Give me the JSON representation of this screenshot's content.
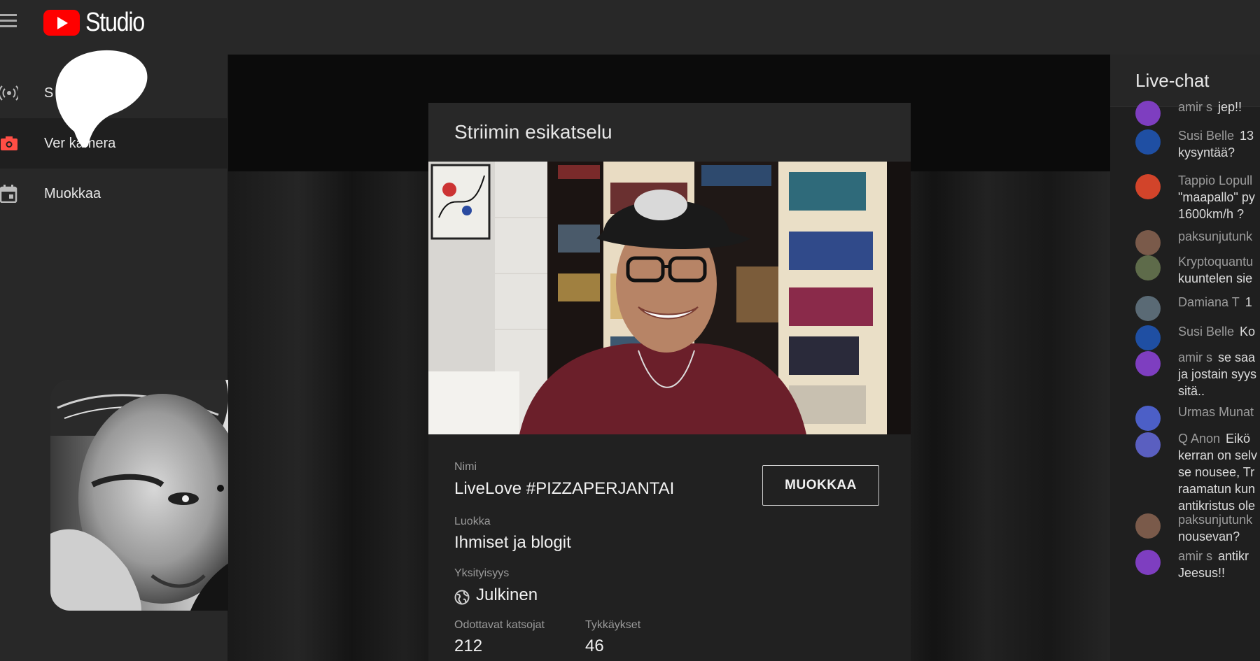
{
  "app": {
    "brand": "Studio"
  },
  "sidebar": {
    "items": [
      {
        "label": "S",
        "icon": "broadcast-icon"
      },
      {
        "label": "Ver kamera",
        "icon": "camera-icon"
      },
      {
        "label": "Muokkaa",
        "icon": "calendar-icon"
      }
    ]
  },
  "preview": {
    "title": "Striimin esikatselu",
    "name_label": "Nimi",
    "name_value": "LiveLove #PIZZAPERJANTAI",
    "edit_button": "MUOKKAA",
    "category_label": "Luokka",
    "category_value": "Ihmiset ja blogit",
    "privacy_label": "Yksityisyys",
    "privacy_value": "Julkinen",
    "viewers_label": "Odottavat katsojat",
    "viewers_value": "212",
    "likes_label": "Tykkäykset",
    "likes_value": "46"
  },
  "chat": {
    "title": "Live-chat",
    "messages": [
      {
        "author": "amir s",
        "text": "jep!!",
        "avatar_color": "#7e3ec0"
      },
      {
        "author": "Susi Belle",
        "text": "13\nkysyntää?",
        "avatar_color": "#1f4fa3"
      },
      {
        "author": "Tappio Lopull",
        "text": "\n\"maapallo\" py\n1600km/h ?",
        "avatar_color": "#d2442a"
      },
      {
        "author": "paksunjutunk",
        "text": "",
        "avatar_color": "#7a5a4a"
      },
      {
        "author": "Kryptoquantu",
        "text": "\nkuuntelen sie",
        "avatar_color": "#5e6b4a"
      },
      {
        "author": "Damiana T",
        "text": "1",
        "avatar_color": "#5a6a75"
      },
      {
        "author": "Susi Belle",
        "text": "Ko",
        "avatar_color": "#1f4fa3"
      },
      {
        "author": "amir s",
        "text": "se saa\nja jostain syys\nsitä..",
        "avatar_color": "#7e3ec0"
      },
      {
        "author": "Urmas Munat",
        "text": "",
        "avatar_color": "#4c5fc7"
      },
      {
        "author": "Q Anon",
        "text": "Eikö\nkerran on selv\nse nousee, Tr\nraamatun kun\nantikristus ole",
        "avatar_color": "#5a5fc0"
      },
      {
        "author": "paksunjutunk",
        "text": "\nnousevan?",
        "avatar_color": "#7a5a4a"
      },
      {
        "author": "amir s",
        "text": "antikr\nJeesus!!",
        "avatar_color": "#7e3ec0"
      }
    ]
  }
}
